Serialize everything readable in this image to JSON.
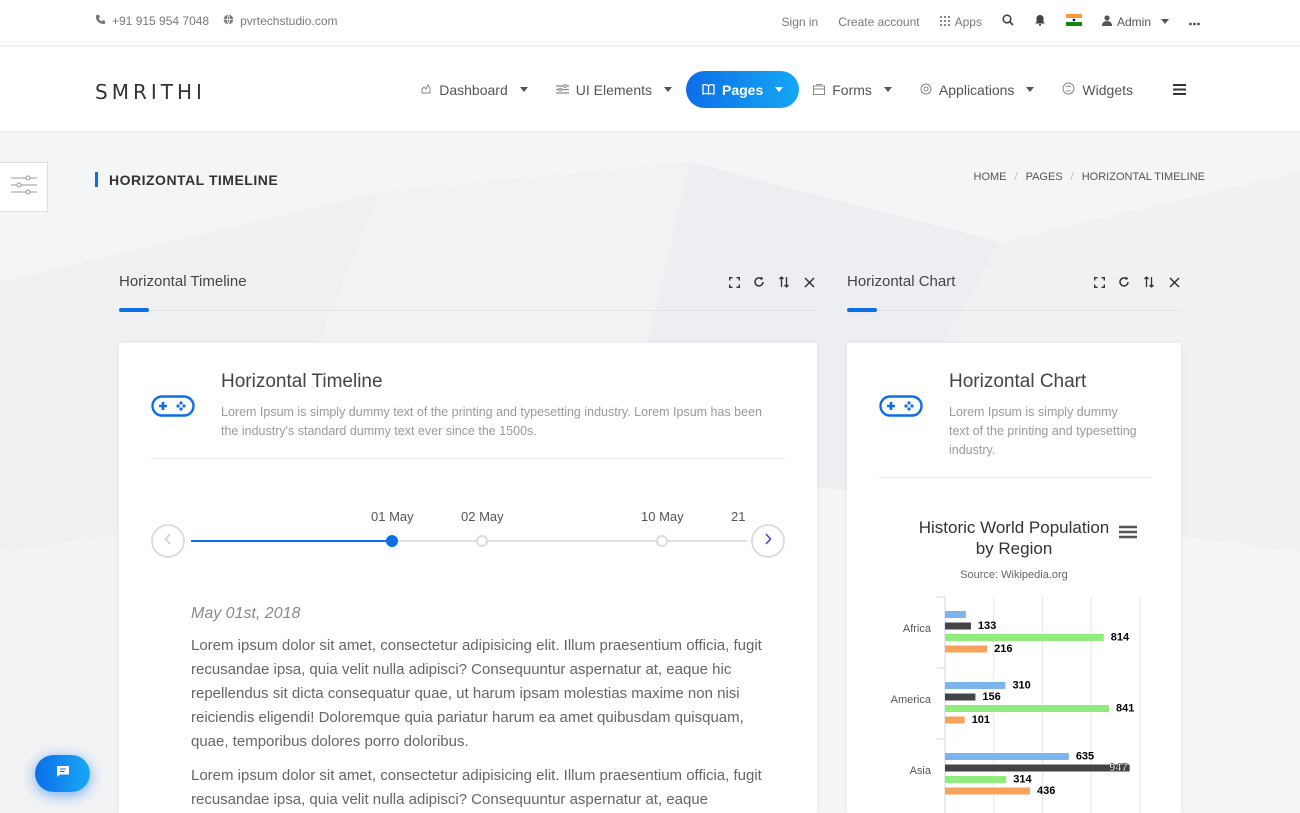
{
  "topbar": {
    "phone": "+91 915 954 7048",
    "website": "pvrtechstudio.com",
    "sign_in": "Sign in",
    "create_account": "Create account",
    "apps": "Apps",
    "admin": "Admin"
  },
  "header": {
    "logo": "SMRITHI",
    "nav": [
      {
        "label": "Dashboard",
        "icon": "dashboard-icon"
      },
      {
        "label": "UI Elements",
        "icon": "ui-elements-icon"
      },
      {
        "label": "Pages",
        "icon": "book-icon"
      },
      {
        "label": "Forms",
        "icon": "forms-icon"
      },
      {
        "label": "Applications",
        "icon": "applications-icon"
      },
      {
        "label": "Widgets",
        "icon": "widgets-icon"
      }
    ]
  },
  "page": {
    "title": "HORIZONTAL TIMELINE",
    "breadcrumb": [
      "HOME",
      "PAGES",
      "HORIZONTAL TIMELINE"
    ]
  },
  "sections": {
    "timeline": "Horizontal Timeline",
    "chart": "Horizontal Chart"
  },
  "timeline_card": {
    "title": "Horizontal Timeline",
    "description": "Lorem Ipsum is simply dummy text of the printing and typesetting industry. Lorem Ipsum has been the industry's standard dummy text ever since the 1500s.",
    "events": [
      "01 May",
      "02 May",
      "10 May",
      "21"
    ],
    "active_index": 0,
    "selected_date": "May 01st, 2018",
    "paragraphs": [
      "Lorem ipsum dolor sit amet, consectetur adipisicing elit. Illum praesentium officia, fugit recusandae ipsa, quia velit nulla adipisci? Consequuntur aspernatur at, eaque hic repellendus sit dicta consequatur quae, ut harum ipsam molestias maxime non nisi reiciendis eligendi! Doloremque quia pariatur harum ea amet quibusdam quisquam, quae, temporibus dolores porro doloribus.",
      "Lorem ipsum dolor sit amet, consectetur adipisicing elit. Illum praesentium officia, fugit recusandae ipsa, quia velit nulla adipisci? Consequuntur aspernatur at, eaque"
    ]
  },
  "chart_card": {
    "title": "Horizontal Chart",
    "description": "Lorem Ipsum is simply dummy text of the printing and typesetting industry."
  },
  "colors": {
    "accent": "#0d6ee8",
    "series": [
      "#7cb5ec",
      "#434348",
      "#90ed7d",
      "#f7a35c"
    ]
  },
  "chart_data": {
    "type": "bar",
    "orientation": "horizontal",
    "title": "Historic World Population by Region",
    "subtitle": "Source: Wikipedia.org",
    "categories": [
      "Africa",
      "America",
      "Asia"
    ],
    "series": [
      {
        "values": [
          107,
          310,
          635
        ],
        "show_labels": [
          false,
          true,
          true
        ]
      },
      {
        "values": [
          133,
          156,
          947
        ],
        "show_labels": [
          true,
          true,
          true
        ]
      },
      {
        "values": [
          814,
          841,
          314
        ],
        "show_labels": [
          true,
          true,
          true
        ]
      },
      {
        "values": [
          216,
          101,
          436
        ],
        "show_labels": [
          true,
          true,
          true
        ]
      }
    ],
    "xlim": [
      0,
      1000
    ],
    "grid": true
  }
}
